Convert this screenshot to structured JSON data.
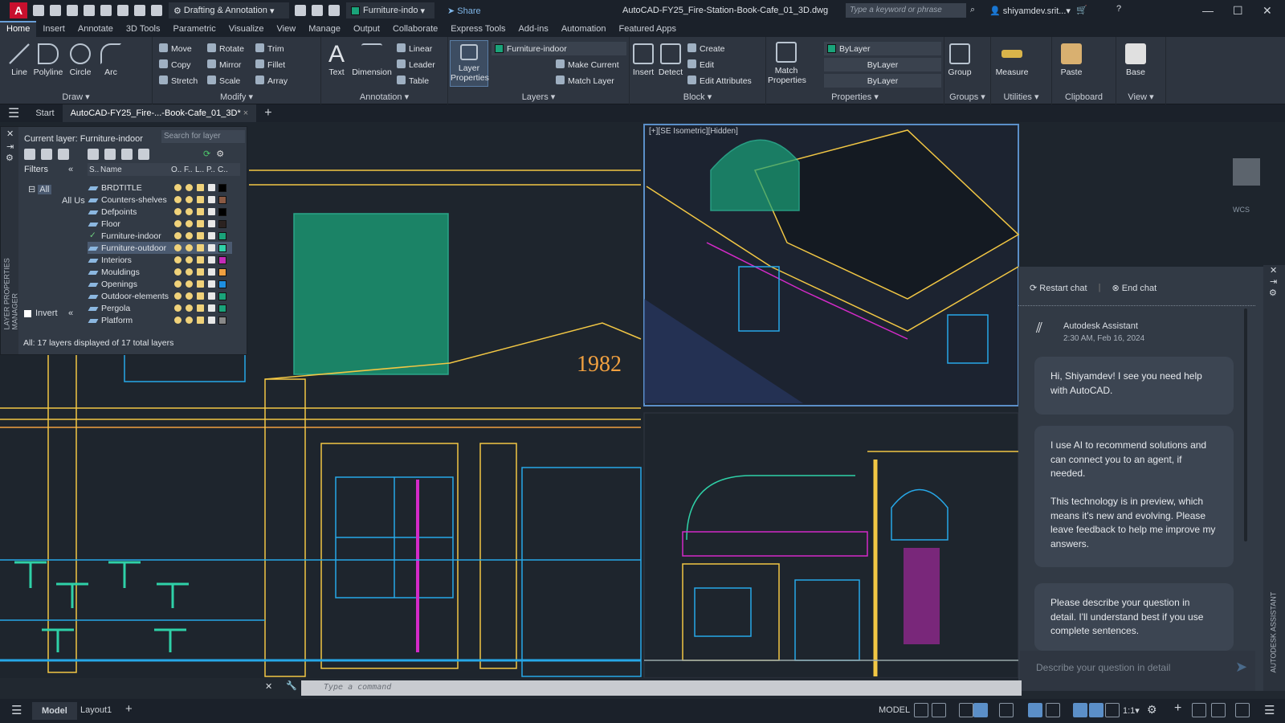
{
  "titlebar": {
    "app_logo": "A",
    "workspace": "Drafting & Annotation",
    "layer": "Furniture-indo",
    "share": "Share",
    "title": "AutoCAD-FY25_Fire-Station-Book-Cafe_01_3D.dwg",
    "search_placeholder": "Type a keyword or phrase",
    "user": "shiyamdev.srit...",
    "minimize": "—",
    "maximize": "☐",
    "close": "✕"
  },
  "ribbon_tabs": [
    "Home",
    "Insert",
    "Annotate",
    "3D Tools",
    "Parametric",
    "Visualize",
    "View",
    "Manage",
    "Output",
    "Collaborate",
    "Express Tools",
    "Add-ins",
    "Automation",
    "Featured Apps"
  ],
  "ribbon": {
    "draw": {
      "title": "Draw",
      "tools": [
        "Line",
        "Polyline",
        "Circle",
        "Arc"
      ]
    },
    "modify": {
      "title": "Modify",
      "items": [
        "Move",
        "Rotate",
        "Trim",
        "Copy",
        "Mirror",
        "Fillet",
        "Stretch",
        "Scale",
        "Array"
      ]
    },
    "annotation": {
      "title": "Annotation",
      "tools": [
        "Text",
        "Dimension"
      ],
      "items": [
        "Linear",
        "Leader",
        "Table"
      ]
    },
    "layers": {
      "title": "Layers",
      "tool": "Layer Properties",
      "current": "Furniture-indoor",
      "items": [
        "Make Current",
        "Match Layer"
      ]
    },
    "block": {
      "title": "Block",
      "tools": [
        "Insert",
        "Detect"
      ],
      "items": [
        "Create",
        "Edit",
        "Edit Attributes"
      ]
    },
    "properties": {
      "title": "Properties",
      "tool": "Match Properties",
      "color": "ByLayer",
      "linetype": "ByLayer",
      "lineweight": "ByLayer"
    },
    "groups": {
      "title": "Groups",
      "tool": "Group"
    },
    "utilities": {
      "title": "Utilities",
      "tool": "Measure"
    },
    "clipboard": {
      "title": "Clipboard",
      "tool": "Paste"
    },
    "view": {
      "title": "View",
      "tool": "Base"
    }
  },
  "file_tabs": {
    "start": "Start",
    "active": "AutoCAD-FY25_Fire-...-Book-Cafe_01_3D*",
    "close": "×",
    "add": "+"
  },
  "viewport": {
    "label": "[+][SE Isometric][Hidden]",
    "annotation": "1982",
    "wcs": "WCS"
  },
  "layer_palette": {
    "side_title": "LAYER PROPERTIES MANAGER",
    "current": "Current layer: Furniture-indoor",
    "search_placeholder": "Search for layer",
    "filters_label": "Filters",
    "tree": [
      "All",
      "All Us"
    ],
    "invert": "Invert",
    "columns": [
      "S..",
      "Name",
      "O..",
      "F..",
      "L..",
      "P..",
      "C.."
    ],
    "layers": [
      {
        "name": "BRDTITLE",
        "color": "#000000"
      },
      {
        "name": "Counters-shelves",
        "color": "#8a5a44"
      },
      {
        "name": "Defpoints",
        "color": "#000000"
      },
      {
        "name": "Floor",
        "color": "#2b2220"
      },
      {
        "name": "Furniture-indoor",
        "color": "#1aa37a",
        "current": true
      },
      {
        "name": "Furniture-outdoor",
        "color": "#2fd1a8",
        "selected": true
      },
      {
        "name": "Interiors",
        "color": "#c42bb8"
      },
      {
        "name": "Mouldings",
        "color": "#f0a040"
      },
      {
        "name": "Openings",
        "color": "#1e8fe0"
      },
      {
        "name": "Outdoor-elements",
        "color": "#1aa37a"
      },
      {
        "name": "Pergola",
        "color": "#1aa37a"
      },
      {
        "name": "Platform",
        "color": "#888888"
      }
    ],
    "status": "All: 17 layers displayed of 17 total layers"
  },
  "chat": {
    "side_title": "AUTODESK ASSISTANT",
    "restart": "Restart chat",
    "end": "End chat",
    "sender": "Autodesk Assistant",
    "time": "2:30 AM, Feb 16, 2024",
    "messages": [
      "Hi, Shiyamdev! I see you need help with AutoCAD.",
      "I use AI to recommend solutions and can connect you to an agent, if needed.\n\nThis technology is in preview, which means it's new and evolving. Please leave feedback to help me improve my answers.",
      "Please describe your question in detail. I'll understand best if you use complete sentences."
    ],
    "input_placeholder": "Describe your question in detail"
  },
  "command": {
    "placeholder": "Type a command"
  },
  "layout_tabs": [
    "Model",
    "Layout1"
  ],
  "status": {
    "model": "MODEL",
    "scale": "1:1"
  },
  "colors": {
    "accent": "#5b8fc8",
    "bg": "#1e252d",
    "ribbon": "#2e3540",
    "yellow": "#f2c744",
    "cyan": "#27a8e8",
    "green": "#2fd1a8",
    "magenta": "#d42ac8"
  }
}
